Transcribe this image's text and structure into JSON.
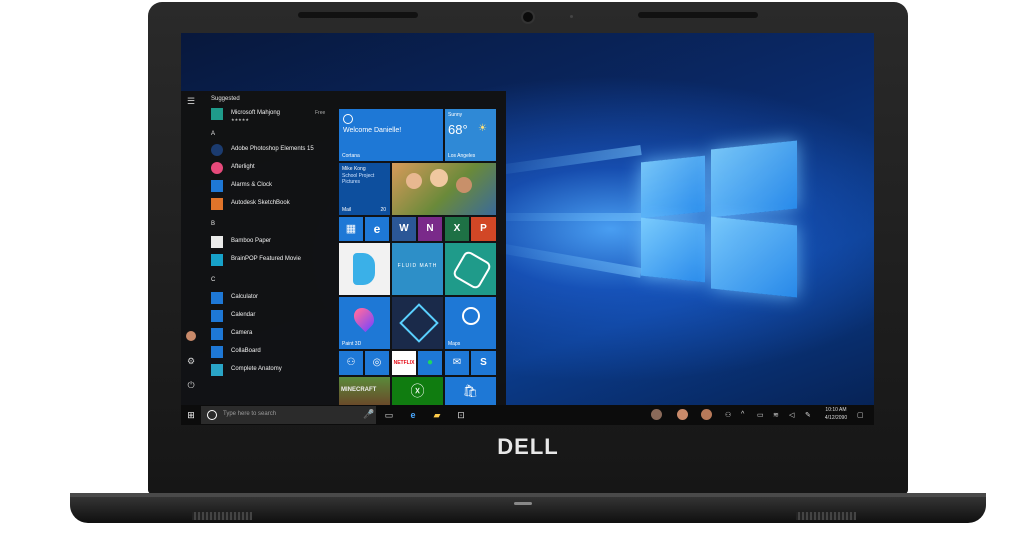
{
  "laptop": {
    "brand_logo": "DELL"
  },
  "start_menu": {
    "suggested_header": "Suggested",
    "suggested": [
      {
        "name": "Microsoft Mahjong",
        "rating": "★★★★★",
        "tag": "Free",
        "icon": "mahjong-icon",
        "color": "#1f9b8a"
      }
    ],
    "groups": [
      {
        "letter": "A",
        "apps": [
          {
            "name": "Adobe Photoshop Elements 15",
            "icon": "photoshop-icon",
            "color": "#1b3b6f"
          },
          {
            "name": "Afterlight",
            "icon": "afterlight-icon",
            "color": "#e64a7b"
          },
          {
            "name": "Alarms & Clock",
            "icon": "clock-icon",
            "color": "#1e78d6"
          },
          {
            "name": "Autodesk SketchBook",
            "icon": "sketchbook-icon",
            "color": "#e0742a"
          }
        ]
      },
      {
        "letter": "B",
        "apps": [
          {
            "name": "Bamboo Paper",
            "icon": "bamboo-icon",
            "color": "#eaeaea"
          },
          {
            "name": "BrainPOP Featured Movie",
            "icon": "brainpop-icon",
            "color": "#17a2c9"
          }
        ]
      },
      {
        "letter": "C",
        "apps": [
          {
            "name": "Calculator",
            "icon": "calculator-icon",
            "color": "#1e78d6"
          },
          {
            "name": "Calendar",
            "icon": "calendar-icon",
            "color": "#1e78d6"
          },
          {
            "name": "Camera",
            "icon": "camera-icon",
            "color": "#1e78d6"
          },
          {
            "name": "CollaBoard",
            "icon": "collaboard-icon",
            "color": "#1e78d6"
          },
          {
            "name": "Complete Anatomy",
            "icon": "anatomy-icon",
            "color": "#2aa5c7"
          }
        ]
      }
    ]
  },
  "tiles": {
    "cortana": {
      "title": "Welcome Danielle!",
      "label": "Cortana"
    },
    "weather": {
      "condition": "Sunny",
      "temp": "68°",
      "city": "Los Angeles"
    },
    "mail": {
      "sender": "Mike Kong",
      "subject": "School Project",
      "preview": "Pictures",
      "label": "Mail",
      "count": "20"
    },
    "fluid_math": "FLUID MATH",
    "paint3d": "Paint 3D",
    "maps": "Maps",
    "netflix": "NETFLIX",
    "minecraft": "MINECRAFT"
  },
  "taskbar": {
    "search_placeholder": "Type here to search",
    "time": "10:10 AM",
    "date": "4/12/2090"
  },
  "colors": {
    "tile_blue": "#1e78d6",
    "tile_dark_blue": "#0d4f9e",
    "taskbar": "#0c0c0c",
    "start_bg": "#121212"
  }
}
